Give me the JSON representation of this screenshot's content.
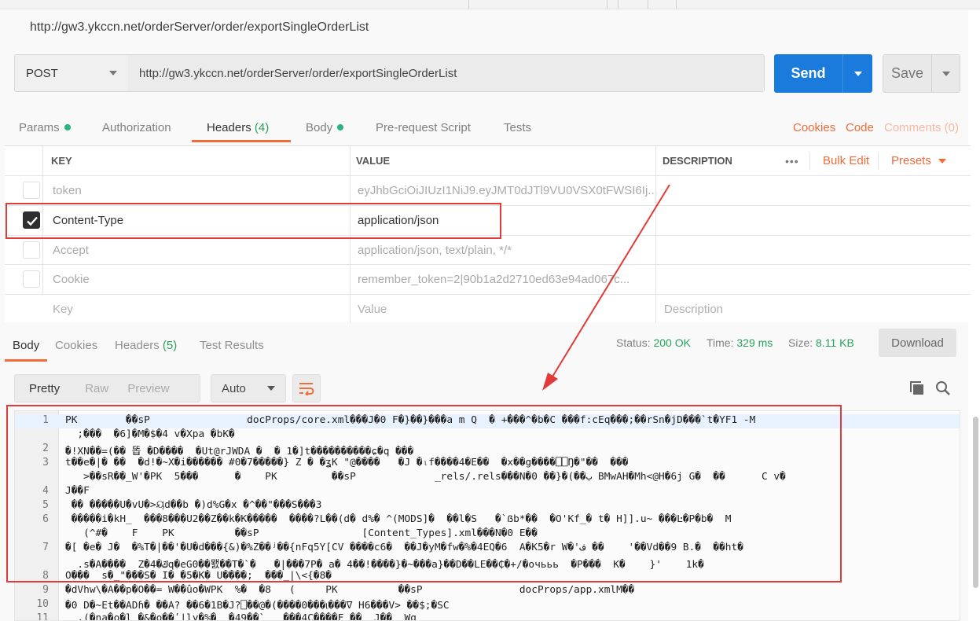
{
  "request": {
    "title": "http://gw3.ykccn.net/orderServer/order/exportSingleOrderList",
    "method": "POST",
    "url": "http://gw3.ykccn.net/orderServer/order/exportSingleOrderList",
    "send_label": "Send",
    "save_label": "Save"
  },
  "request_tabs": {
    "params": "Params",
    "authorization": "Authorization",
    "headers": "Headers",
    "headers_count": "(4)",
    "body": "Body",
    "prerequest": "Pre-request Script",
    "tests": "Tests",
    "cookies": "Cookies",
    "code": "Code",
    "comments": "Comments (0)"
  },
  "headers_table": {
    "col_key": "KEY",
    "col_value": "VALUE",
    "col_description": "DESCRIPTION",
    "more": "•••",
    "bulk_edit": "Bulk Edit",
    "presets": "Presets",
    "rows": [
      {
        "key": "token",
        "value": "eyJhbGciOiJIUzI1NiJ9.eyJMT0dJTl9VU0VSX0tFWSI6Ij...",
        "checked": false
      },
      {
        "key": "Content-Type",
        "value": "application/json",
        "checked": true
      },
      {
        "key": "Accept",
        "value": "application/json, text/plain, */*",
        "checked": false
      },
      {
        "key": "Cookie",
        "value": "remember_token=2|90b1a2d2710ed63e94ad067c...",
        "checked": false
      }
    ],
    "placeholder_key": "Key",
    "placeholder_value": "Value",
    "placeholder_description": "Description"
  },
  "response_tabs": {
    "body": "Body",
    "cookies": "Cookies",
    "headers": "Headers",
    "headers_count": "(5)",
    "test_results": "Test Results"
  },
  "response_status": {
    "status_label": "Status:",
    "status_value": "200 OK",
    "time_label": "Time:",
    "time_value": "329 ms",
    "size_label": "Size:",
    "size_value": "8.11 KB",
    "download_label": "Download"
  },
  "view_modes": {
    "pretty": "Pretty",
    "raw": "Raw",
    "preview": "Preview",
    "format": "Auto"
  },
  "body_lines": [
    {
      "num": "1",
      "text": "PK        ��sP                docProps/core.xml���J�0 F�}��}���a m Q  � +���^�b�C ���f:cEq���;��rSn�jD���`t�YF1 -M"
    },
    {
      "num": "",
      "text": "  ;���  �6]�M�$�4 v�Xpa �bK�"
    },
    {
      "num": "2",
      "text": "�!XN��=(�� 똡 �D����  �Ut@rJWDA �  � 1�]t����������ɕ�q ���"
    },
    {
      "num": "3",
      "text": "t��e�|� ��  �d!�~X�i������ #0�7�����} Z � �ʓK \"@����   �J �ₗf����4�E��  �x��g����⎕⎕Ŋ�\"��  ���"
    },
    {
      "num": "",
      "text": "   >��sR��_W'�PK  5���      �    PK         ��sP             _rels/.rels���N�0 ��}�(��ب BMwAH�Mh<@H�6j G�  ��      C v�"
    },
    {
      "num": "4",
      "text": "J��F"
    },
    {
      "num": "5",
      "text": " �� �����U�vU�>ୟd��b �)d%G�x �^��\"���S���3"
    },
    {
      "num": "6",
      "text": " �����i�kH_  ���8���U2��Z��k�K�����  ����?L��(d� d%� ^(MODS]�  ��l�S   �`ẞb*��  �O'Kf_� t� H]].u~ ���Ŀ�P�b�  M"
    },
    {
      "num": "",
      "text": "   (^#�    F    PK          ��sP                 [Content_Types].xml���N�0 E��"
    },
    {
      "num": "7",
      "text": "�[ �e� J�  �%T�|��'�U�d���{&)�%Z��ʲ��{nFq5Y[CV ����c6�  ��J�yM�fw�%�4EQ�6  A�K5�r W�'ف ��    '��Vd��9 B.�  ��ht�"
    },
    {
      "num": "",
      "text": "  .s�A����  Z�4�ݿq�eG0��뫬��T�`�   �|���7P� a� 4��!����}�~���a}��D��LE��₵�+/�очььь  �P���  K�    }'    1k�"
    },
    {
      "num": "8",
      "text": "O���  s�_\"���S� I� �5�K� U����;  ���_|\\<{�8�"
    },
    {
      "num": "9",
      "text": "�dVhw\\�A��p�O��= W��ûo�WPK  %�  �8   (     PK          ��sP                docProps/app.xmlM��"
    },
    {
      "num": "10",
      "text": "�0 D�~Et��ADɦ� ��A? ��6�1B�J?⎕��@�(����ࡵ���0���∇ H6���V> ��$;�SC"
    },
    {
      "num": "11",
      "text": "  ,(�na�o�l �&�o��ʹ|ly�%�  �49��`   ���4C����F ��  J��  Wq"
    }
  ]
}
